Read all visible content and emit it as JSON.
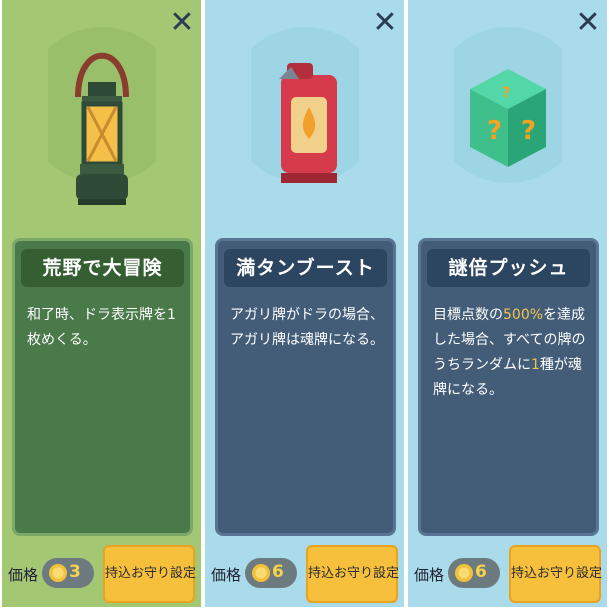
{
  "cards": [
    {
      "title": "荒野で大冒険",
      "description": "和了時、ドラ表示牌を1枚めくる。",
      "price_label": "価格",
      "price": "3",
      "button_label": "持込お守り設定",
      "icon": "lantern-icon",
      "theme": "#a4c774"
    },
    {
      "title": "満タンブースト",
      "description": "アガリ牌がドラの場合、アガリ牌は魂牌になる。",
      "price_label": "価格",
      "price": "6",
      "button_label": "持込お守り設定",
      "icon": "fuel-can-icon",
      "theme": "#a9dbea"
    },
    {
      "title": "謎倍プッシュ",
      "description_parts": [
        "目標点数の",
        "500%",
        "を達成した場合、すべての牌のうちランダムに",
        "1",
        "種が魂牌になる。"
      ],
      "price_label": "価格",
      "price": "6",
      "button_label": "持込お守り設定",
      "icon": "mystery-box-icon",
      "theme": "#a9dbea"
    }
  ]
}
